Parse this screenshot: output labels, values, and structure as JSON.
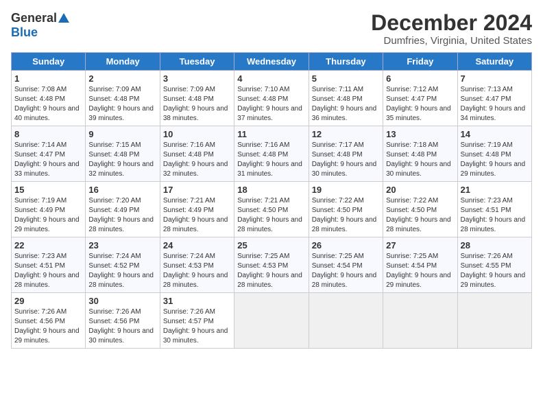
{
  "header": {
    "logo_general": "General",
    "logo_blue": "Blue",
    "title": "December 2024",
    "location": "Dumfries, Virginia, United States"
  },
  "days_of_week": [
    "Sunday",
    "Monday",
    "Tuesday",
    "Wednesday",
    "Thursday",
    "Friday",
    "Saturday"
  ],
  "weeks": [
    [
      {
        "day": "1",
        "sunrise": "7:08 AM",
        "sunset": "4:48 PM",
        "daylight": "9 hours and 40 minutes."
      },
      {
        "day": "2",
        "sunrise": "7:09 AM",
        "sunset": "4:48 PM",
        "daylight": "9 hours and 39 minutes."
      },
      {
        "day": "3",
        "sunrise": "7:09 AM",
        "sunset": "4:48 PM",
        "daylight": "9 hours and 38 minutes."
      },
      {
        "day": "4",
        "sunrise": "7:10 AM",
        "sunset": "4:48 PM",
        "daylight": "9 hours and 37 minutes."
      },
      {
        "day": "5",
        "sunrise": "7:11 AM",
        "sunset": "4:48 PM",
        "daylight": "9 hours and 36 minutes."
      },
      {
        "day": "6",
        "sunrise": "7:12 AM",
        "sunset": "4:47 PM",
        "daylight": "9 hours and 35 minutes."
      },
      {
        "day": "7",
        "sunrise": "7:13 AM",
        "sunset": "4:47 PM",
        "daylight": "9 hours and 34 minutes."
      }
    ],
    [
      {
        "day": "8",
        "sunrise": "7:14 AM",
        "sunset": "4:47 PM",
        "daylight": "9 hours and 33 minutes."
      },
      {
        "day": "9",
        "sunrise": "7:15 AM",
        "sunset": "4:48 PM",
        "daylight": "9 hours and 32 minutes."
      },
      {
        "day": "10",
        "sunrise": "7:16 AM",
        "sunset": "4:48 PM",
        "daylight": "9 hours and 32 minutes."
      },
      {
        "day": "11",
        "sunrise": "7:16 AM",
        "sunset": "4:48 PM",
        "daylight": "9 hours and 31 minutes."
      },
      {
        "day": "12",
        "sunrise": "7:17 AM",
        "sunset": "4:48 PM",
        "daylight": "9 hours and 30 minutes."
      },
      {
        "day": "13",
        "sunrise": "7:18 AM",
        "sunset": "4:48 PM",
        "daylight": "9 hours and 30 minutes."
      },
      {
        "day": "14",
        "sunrise": "7:19 AM",
        "sunset": "4:48 PM",
        "daylight": "9 hours and 29 minutes."
      }
    ],
    [
      {
        "day": "15",
        "sunrise": "7:19 AM",
        "sunset": "4:49 PM",
        "daylight": "9 hours and 29 minutes."
      },
      {
        "day": "16",
        "sunrise": "7:20 AM",
        "sunset": "4:49 PM",
        "daylight": "9 hours and 28 minutes."
      },
      {
        "day": "17",
        "sunrise": "7:21 AM",
        "sunset": "4:49 PM",
        "daylight": "9 hours and 28 minutes."
      },
      {
        "day": "18",
        "sunrise": "7:21 AM",
        "sunset": "4:50 PM",
        "daylight": "9 hours and 28 minutes."
      },
      {
        "day": "19",
        "sunrise": "7:22 AM",
        "sunset": "4:50 PM",
        "daylight": "9 hours and 28 minutes."
      },
      {
        "day": "20",
        "sunrise": "7:22 AM",
        "sunset": "4:50 PM",
        "daylight": "9 hours and 28 minutes."
      },
      {
        "day": "21",
        "sunrise": "7:23 AM",
        "sunset": "4:51 PM",
        "daylight": "9 hours and 28 minutes."
      }
    ],
    [
      {
        "day": "22",
        "sunrise": "7:23 AM",
        "sunset": "4:51 PM",
        "daylight": "9 hours and 28 minutes."
      },
      {
        "day": "23",
        "sunrise": "7:24 AM",
        "sunset": "4:52 PM",
        "daylight": "9 hours and 28 minutes."
      },
      {
        "day": "24",
        "sunrise": "7:24 AM",
        "sunset": "4:53 PM",
        "daylight": "9 hours and 28 minutes."
      },
      {
        "day": "25",
        "sunrise": "7:25 AM",
        "sunset": "4:53 PM",
        "daylight": "9 hours and 28 minutes."
      },
      {
        "day": "26",
        "sunrise": "7:25 AM",
        "sunset": "4:54 PM",
        "daylight": "9 hours and 28 minutes."
      },
      {
        "day": "27",
        "sunrise": "7:25 AM",
        "sunset": "4:54 PM",
        "daylight": "9 hours and 29 minutes."
      },
      {
        "day": "28",
        "sunrise": "7:26 AM",
        "sunset": "4:55 PM",
        "daylight": "9 hours and 29 minutes."
      }
    ],
    [
      {
        "day": "29",
        "sunrise": "7:26 AM",
        "sunset": "4:56 PM",
        "daylight": "9 hours and 29 minutes."
      },
      {
        "day": "30",
        "sunrise": "7:26 AM",
        "sunset": "4:56 PM",
        "daylight": "9 hours and 30 minutes."
      },
      {
        "day": "31",
        "sunrise": "7:26 AM",
        "sunset": "4:57 PM",
        "daylight": "9 hours and 30 minutes."
      },
      null,
      null,
      null,
      null
    ]
  ]
}
